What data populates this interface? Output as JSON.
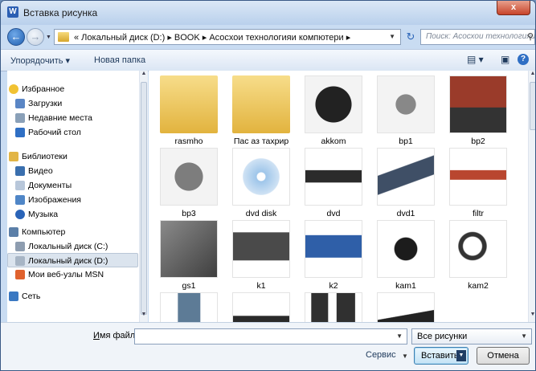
{
  "window": {
    "title": "Вставка рисунка",
    "app_icon_letter": "W",
    "close": "x"
  },
  "nav": {
    "breadcrumb": "«  Локальный диск (D:)  ▸  BOOK  ▸  Асосхои технологияи компютери  ▸",
    "search_placeholder": "Поиск: Асосхои технологияи ..."
  },
  "toolbar": {
    "organize": "Упорядочить ▾",
    "new_folder": "Новая папка"
  },
  "sidebar": {
    "items": [
      {
        "label": "Избранное",
        "icon": "star-icon",
        "color": "#f1c232"
      },
      {
        "label": "Загрузки",
        "icon": "downloads-icon",
        "color": "#5a86c5"
      },
      {
        "label": "Недавние места",
        "icon": "recent-places-icon",
        "color": "#8aa0b8"
      },
      {
        "label": "Рабочий стол",
        "icon": "desktop-icon",
        "color": "#2f6fc4"
      },
      {
        "label": "Библиотеки",
        "icon": "libraries-icon",
        "color": "#e2b546"
      },
      {
        "label": "Видео",
        "icon": "video-icon",
        "color": "#3a6fae"
      },
      {
        "label": "Документы",
        "icon": "documents-icon",
        "color": "#b8c7da"
      },
      {
        "label": "Изображения",
        "icon": "pictures-icon",
        "color": "#4f86c7"
      },
      {
        "label": "Музыка",
        "icon": "music-icon",
        "color": "#2a64b8"
      },
      {
        "label": "Компьютер",
        "icon": "computer-icon",
        "color": "#5b7fa8"
      },
      {
        "label": "Локальный диск (C:)",
        "icon": "drive-c-icon",
        "color": "#8e9db0"
      },
      {
        "label": "Локальный диск (D:)",
        "icon": "drive-d-icon",
        "color": "#a7b5c5"
      },
      {
        "label": "Мои веб-узлы MSN",
        "icon": "msn-icon",
        "color": "#e0622e"
      },
      {
        "label": "Сеть",
        "icon": "network-icon",
        "color": "#3a78c2"
      }
    ]
  },
  "files": [
    {
      "name": "rasmho",
      "kind": "folder"
    },
    {
      "name": "Пас аз тахрир",
      "kind": "folder"
    },
    {
      "name": "akkom",
      "kind": "image",
      "color": "#222"
    },
    {
      "name": "bp1",
      "kind": "image",
      "color": "#888"
    },
    {
      "name": "bp2",
      "kind": "image",
      "color": "#9a3b2a"
    },
    {
      "name": "bp3",
      "kind": "image",
      "color": "#7d7d7d"
    },
    {
      "name": "dvd disk",
      "kind": "image",
      "color": "#9fc6ea"
    },
    {
      "name": "dvd",
      "kind": "image",
      "color": "#2b2b2b"
    },
    {
      "name": "dvd1",
      "kind": "image",
      "color": "#3f4f66"
    },
    {
      "name": "filtr",
      "kind": "image",
      "color": "#b9462f"
    },
    {
      "name": "gs1",
      "kind": "image",
      "color": "#5f5f5f"
    },
    {
      "name": "k1",
      "kind": "image",
      "color": "#4a4a4a"
    },
    {
      "name": "k2",
      "kind": "image",
      "color": "#2f5fa8"
    },
    {
      "name": "kam1",
      "kind": "image",
      "color": "#1c1c1c"
    },
    {
      "name": "kam2",
      "kind": "image",
      "color": "#333"
    },
    {
      "name": "",
      "kind": "image",
      "color": "#5d7b96"
    },
    {
      "name": "",
      "kind": "image",
      "color": "#2a2a2a"
    },
    {
      "name": "",
      "kind": "image",
      "color": "#303030"
    },
    {
      "name": "",
      "kind": "image",
      "color": "#222"
    }
  ],
  "bottom": {
    "filename_label_pre": "И",
    "filename_label_rest": "мя файла:",
    "filename_value": "",
    "filter_value": "Все рисунки",
    "service": "Сервис",
    "insert": "Вставить",
    "cancel": "Отмена"
  }
}
